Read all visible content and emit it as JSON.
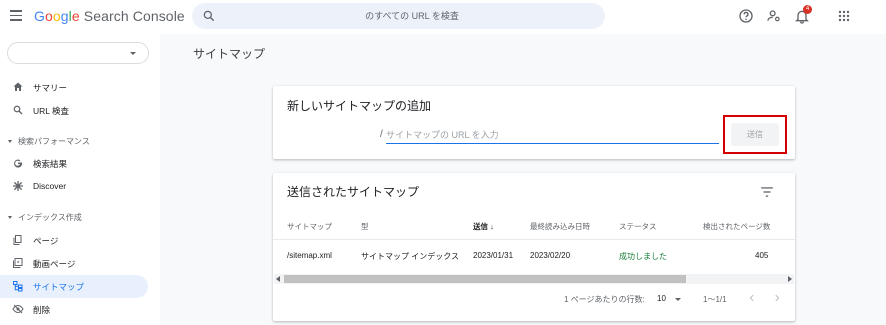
{
  "app": {
    "logo_letters": [
      "G",
      "o",
      "o",
      "g",
      "l",
      "e"
    ],
    "product": "Search Console"
  },
  "search": {
    "placeholder": "のすべての URL を検査"
  },
  "topbar": {
    "notification_count": "4",
    "icons": [
      "help-icon",
      "manage-users-icon",
      "notifications-icon",
      "apps-grid-icon"
    ]
  },
  "sidebar": {
    "property_value": "",
    "items_top": [
      {
        "label": "サマリー",
        "icon": "home-icon"
      },
      {
        "label": "URL 検査",
        "icon": "search-icon"
      }
    ],
    "section_performance": "検索パフォーマンス",
    "items_performance": [
      {
        "label": "検索結果",
        "icon": "google-g-icon"
      },
      {
        "label": "Discover",
        "icon": "discover-asterisk-icon"
      }
    ],
    "section_index": "インデックス作成",
    "items_index": [
      {
        "label": "ページ",
        "icon": "pages-icon"
      },
      {
        "label": "動画ページ",
        "icon": "video-pages-icon"
      },
      {
        "label": "サイトマップ",
        "icon": "sitemap-icon",
        "active": true
      },
      {
        "label": "削除",
        "icon": "removals-icon"
      }
    ]
  },
  "main": {
    "page_title": "サイトマップ",
    "add_card": {
      "title": "新しいサイトマップの追加",
      "prefix": "/",
      "input_placeholder": "サイトマップの URL を入力",
      "input_value": "",
      "submit_label": "送信"
    },
    "submitted_card": {
      "title": "送信されたサイトマップ",
      "columns": [
        "サイトマップ",
        "型",
        "送信",
        "最終読み込み日時",
        "ステータス",
        "検出されたページ数"
      ],
      "sort_arrow": "↓",
      "rows": [
        {
          "sitemap": "/sitemap.xml",
          "type": "サイトマップ インデックス",
          "submitted": "2023/01/31",
          "last_read": "2023/02/20",
          "status": "成功しました",
          "pages": "405"
        }
      ],
      "pagination": {
        "rows_per_page_label": "1 ページあたりの行数:",
        "rows_per_page_value": "10",
        "range": "1〜1/1"
      }
    }
  },
  "colors": {
    "accent": "#1a73e8",
    "success": "#188038",
    "highlight_box": "#d50000",
    "badge": "#d93025",
    "active_nav_bg": "#e8f0fe"
  }
}
